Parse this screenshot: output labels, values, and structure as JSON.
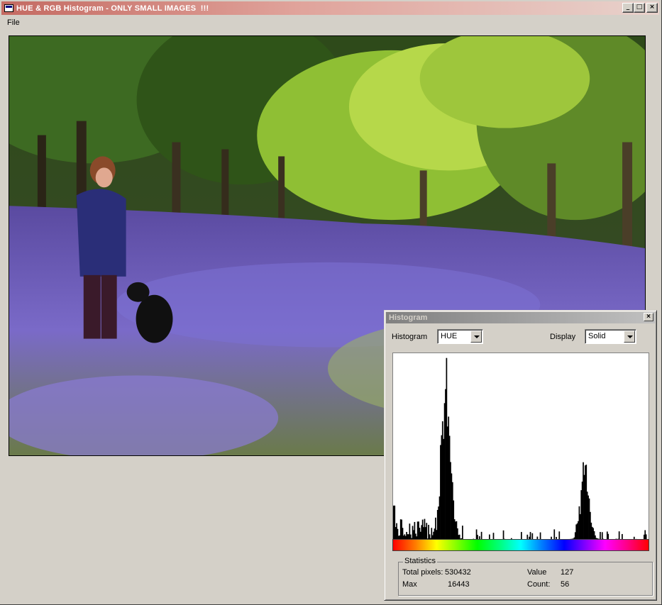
{
  "window": {
    "title": "HUE & RGB Histogram - ONLY SMALL IMAGES  !!!",
    "buttons": {
      "minimize": "_",
      "maximize": "□",
      "close": "×"
    }
  },
  "menu": {
    "items": [
      "File"
    ]
  },
  "image": {
    "description_icon": "photo"
  },
  "histogram_window": {
    "title": "Histogram",
    "histogram_label": "Histogram",
    "histogram_value": "HUE",
    "display_label": "Display",
    "display_value": "Solid",
    "statistics": {
      "group_label": "Statistics",
      "total_pixels_label": "Total pixels:",
      "total_pixels_value": "530432",
      "max_label": "Max",
      "max_value": "16443",
      "value_label": "Value",
      "value_value": "127",
      "count_label": "Count:",
      "count_value": "56"
    }
  },
  "chart_data": {
    "type": "bar",
    "xlim": [
      0,
      255
    ],
    "ylim": [
      0,
      16443
    ],
    "peaks": [
      {
        "center": 52,
        "height": 16443,
        "width": 4
      },
      {
        "center": 192,
        "height": 7400,
        "width": 4
      }
    ],
    "baseline": 300
  }
}
